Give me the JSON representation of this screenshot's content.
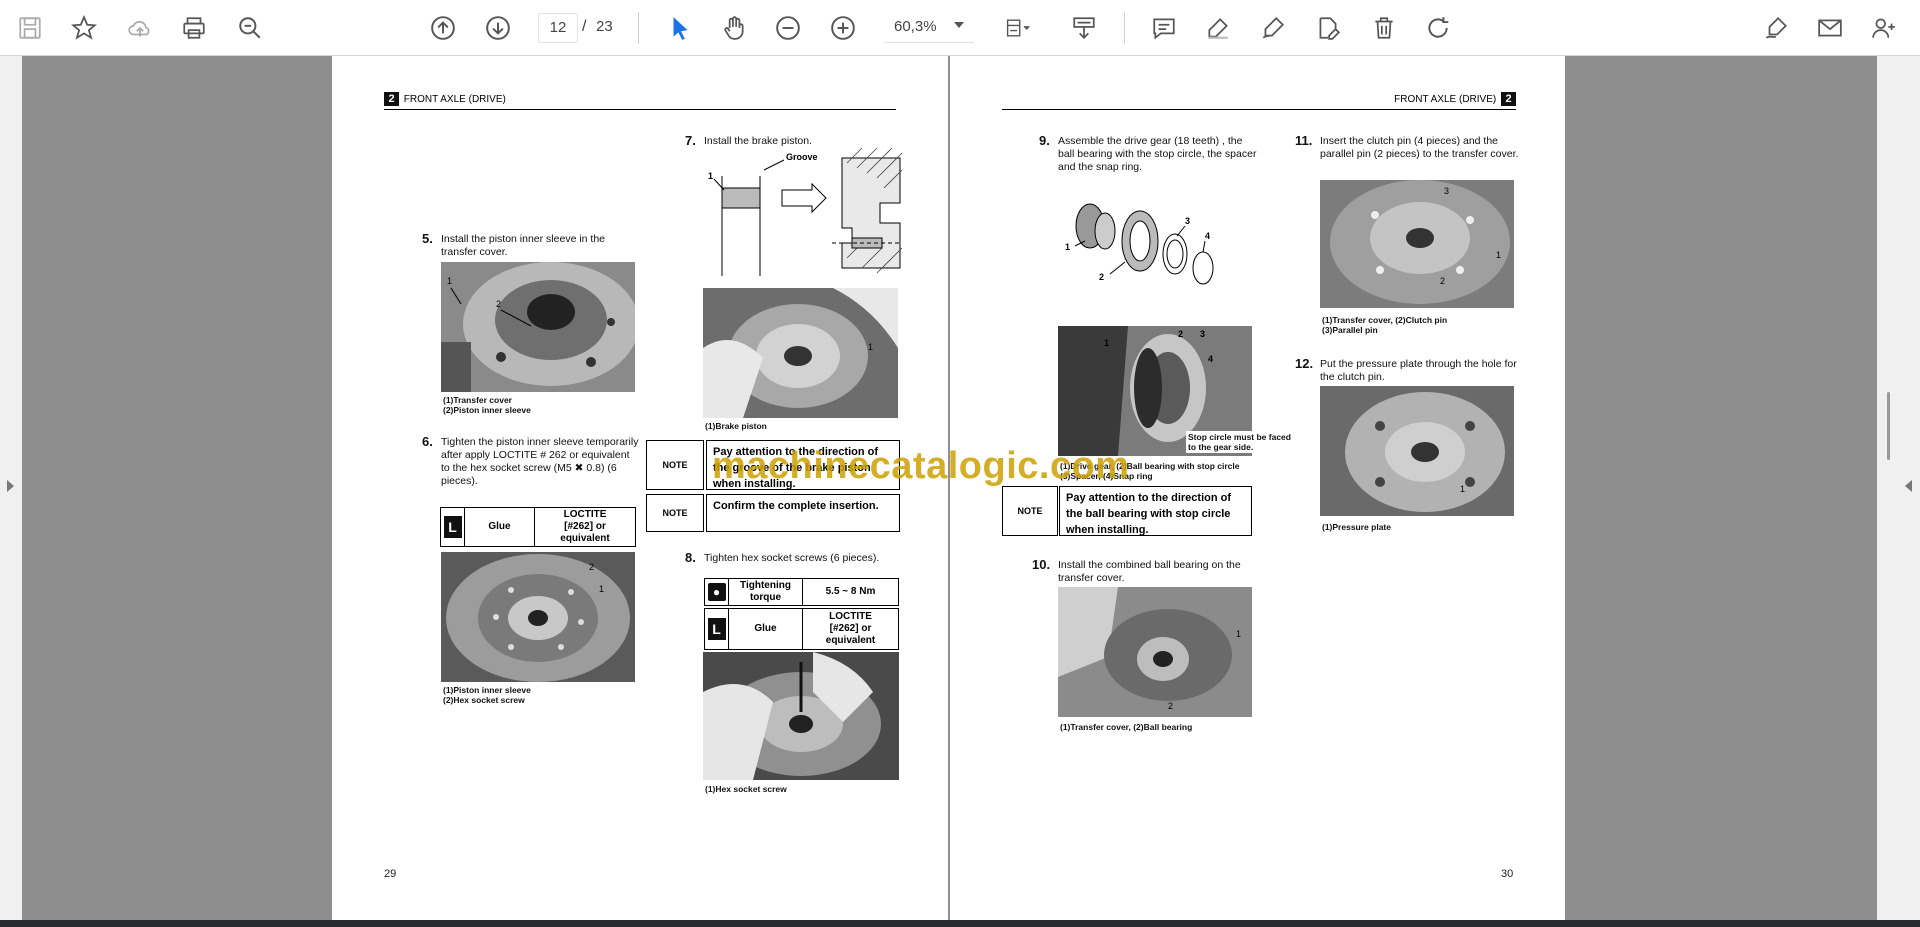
{
  "toolbar": {
    "page_current": "12",
    "page_sep": "/",
    "page_total": "23",
    "zoom": "60,3%",
    "icons": [
      "save-icon",
      "star-icon",
      "cloud-upload-icon",
      "print-icon",
      "zoom-search-icon",
      "page-up-icon",
      "page-down-icon",
      "select-cursor-icon",
      "hand-icon",
      "zoom-out-icon",
      "zoom-in-icon",
      "page-fit-icon",
      "scroll-mode-icon",
      "comment-icon",
      "highlight-pen-icon",
      "draw-pen-icon",
      "edit-pdf-icon",
      "delete-icon",
      "rotate-icon",
      "sign-icon",
      "email-icon",
      "add-user-icon"
    ]
  },
  "watermark": "machinecatalogic.com",
  "left_page": {
    "header": "FRONT AXLE (DRIVE)",
    "chapter": "2",
    "page_number": "29",
    "step5": {
      "num": "5.",
      "text": "Install the piston inner sleeve in the transfer cover."
    },
    "step5_cap": [
      "(1)Transfer cover",
      "(2)Piston inner sleeve"
    ],
    "step6": {
      "num": "6.",
      "text": "Tighten the piston inner sleeve temporarily after apply LOCTITE # 262 or equivalent to the hex socket screw (M5 ✖ 0.8) (6 pieces)."
    },
    "step6_table": {
      "icon": "L",
      "label": "Glue",
      "value_lines": [
        "LOCTITE",
        "[#262] or",
        "equivalent"
      ]
    },
    "step6_cap": [
      "(1)Piston inner sleeve",
      "(2)Hex socket screw"
    ],
    "step7": {
      "num": "7.",
      "text": "Install the brake piston."
    },
    "diagram_labels": {
      "groove": "Groove",
      "one": "1"
    },
    "step7_cap": [
      "(1)Brake piston"
    ],
    "note1": {
      "icon": "NOTE",
      "text": "Pay attention to the direction of the groove of the brake piston when installing."
    },
    "note2": {
      "icon": "NOTE",
      "text": "Confirm the complete insertion."
    },
    "step8": {
      "num": "8.",
      "text": "Tighten hex socket screws (6 pieces)."
    },
    "step8_torque": {
      "label_lines": [
        "Tightening",
        "torque"
      ],
      "value": "5.5 ~ 8 Nm"
    },
    "step8_glue": {
      "icon": "L",
      "label": "Glue",
      "value_lines": [
        "LOCTITE",
        "[#262] or",
        "equivalent"
      ]
    },
    "step8_cap": [
      "(1)Hex socket screw"
    ]
  },
  "right_page": {
    "header": "FRONT AXLE (DRIVE)",
    "chapter": "2",
    "page_number": "30",
    "step9": {
      "num": "9.",
      "text": "Assemble the drive gear (18 teeth) , the ball bearing with the stop circle, the spacer and the snap ring."
    },
    "step9_labels": [
      "1",
      "2",
      "3",
      "4"
    ],
    "step9_photo_note": [
      "Stop circle must be faced",
      "to the gear side."
    ],
    "step9_cap": [
      "(1)Drive gear, (2)Ball bearing with stop circle",
      "(3)Spacer, (4)Snap ring"
    ],
    "note3": {
      "icon": "NOTE",
      "text": "Pay attention to the direction of the ball bearing with stop circle when installing."
    },
    "step10": {
      "num": "10.",
      "text": "Install the combined ball bearing on the transfer cover."
    },
    "step10_cap": [
      "(1)Transfer cover, (2)Ball bearing"
    ],
    "step11": {
      "num": "11.",
      "text": "Insert the clutch pin (4 pieces) and the parallel pin (2 pieces) to the transfer cover."
    },
    "step11_cap": [
      "(1)Transfer cover, (2)Clutch pin",
      "(3)Parallel pin"
    ],
    "step12": {
      "num": "12.",
      "text": "Put the pressure plate through the hole for the clutch pin."
    },
    "step12_cap": [
      "(1)Pressure plate"
    ]
  }
}
